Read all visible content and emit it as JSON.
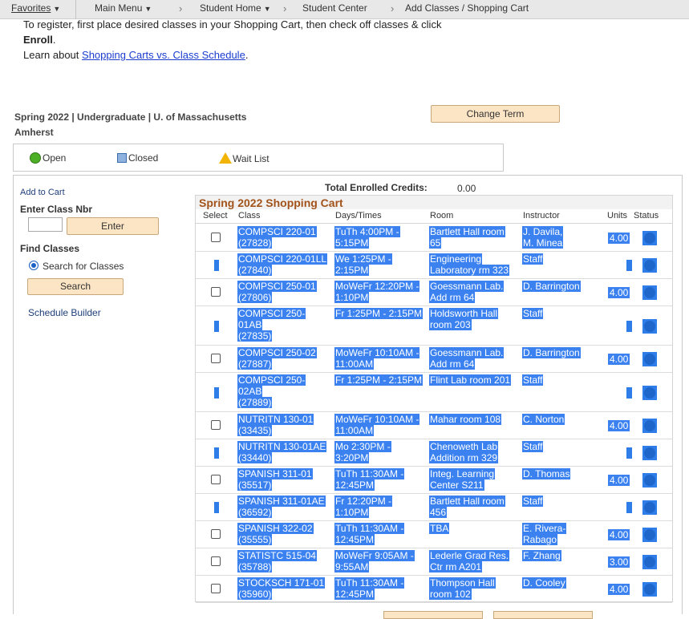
{
  "nav": {
    "favorites": "Favorites",
    "main_menu": "Main Menu",
    "student_home": "Student Home",
    "student_center": "Student Center",
    "add_classes": "Add Classes / Shopping Cart"
  },
  "intro": {
    "line1": "To register, first place desired classes in your Shopping Cart, then check off classes & click",
    "enroll": "Enroll",
    "learn_prefix": "Learn about",
    "learn_link": "Shopping Carts vs. Class Schedule"
  },
  "term": {
    "line1": "Spring 2022 | Undergraduate | U. of Massachusetts",
    "line2": "Amherst",
    "change_term": "Change Term"
  },
  "legend": {
    "open": "Open",
    "closed": "Closed",
    "wait": "Wait List"
  },
  "sidebar": {
    "add_to_cart": "Add to Cart",
    "enter_class_nbr": "Enter Class Nbr",
    "enter_btn": "Enter",
    "find_classes": "Find Classes",
    "search_for_classes": "Search for Classes",
    "search_btn": "Search",
    "schedule_builder": "Schedule Builder"
  },
  "credits": {
    "label": "Total Enrolled Credits:",
    "value": "0.00"
  },
  "cart": {
    "title": "Spring 2022 Shopping Cart",
    "columns": [
      "Select",
      "Class",
      "Days/Times",
      "Room",
      "Instructor",
      "Units",
      "Status"
    ],
    "rows": [
      {
        "class1": "COMPSCI 220-01",
        "class2": "(27828)",
        "class3": "",
        "dt1": "TuTh 4:00PM -",
        "dt2": "5:15PM",
        "room1": "Bartlett Hall room",
        "room2": "65",
        "instr1": "J. Davila,",
        "instr2": "M. Minea",
        "units": "4.00",
        "selectable": true
      },
      {
        "class1": "COMPSCI 220-01LL",
        "class2": "(27840)",
        "class3": "",
        "dt1": "We 1:25PM -",
        "dt2": "2:15PM",
        "room1": "Engineering",
        "room2": "Laboratory rm 323",
        "instr1": "Staff",
        "instr2": "",
        "units": "",
        "selectable": false
      },
      {
        "class1": "COMPSCI 250-01",
        "class2": "(27806)",
        "class3": "",
        "dt1": "MoWeFr 12:20PM -",
        "dt2": "1:10PM",
        "room1": "Goessmann Lab.",
        "room2": "Add rm 64",
        "instr1": "D. Barrington",
        "instr2": "",
        "units": "4.00",
        "selectable": true
      },
      {
        "class1": "COMPSCI 250-",
        "class2": "01AB",
        "class3": "(27835)",
        "dt1": "Fr 1:25PM - 2:15PM",
        "dt2": "",
        "room1": "Holdsworth Hall",
        "room2": "room 203",
        "instr1": "Staff",
        "instr2": "",
        "units": "",
        "selectable": false
      },
      {
        "class1": "COMPSCI 250-02",
        "class2": "(27887)",
        "class3": "",
        "dt1": "MoWeFr 10:10AM -",
        "dt2": "11:00AM",
        "room1": "Goessmann Lab.",
        "room2": "Add rm 64",
        "instr1": "D. Barrington",
        "instr2": "",
        "units": "4.00",
        "selectable": true
      },
      {
        "class1": "COMPSCI 250-",
        "class2": "02AB",
        "class3": "(27889)",
        "dt1": "Fr 1:25PM - 2:15PM",
        "dt2": "",
        "room1": "Flint Lab room 201",
        "room2": "",
        "instr1": "Staff",
        "instr2": "",
        "units": "",
        "selectable": false
      },
      {
        "class1": "NUTRITN 130-01",
        "class2": "(33435)",
        "class3": "",
        "dt1": "MoWeFr 10:10AM -",
        "dt2": "11:00AM",
        "room1": "Mahar room 108",
        "room2": "",
        "instr1": "C. Norton",
        "instr2": "",
        "units": "4.00",
        "selectable": true
      },
      {
        "class1": "NUTRITN 130-01AE",
        "class2": "(33440)",
        "class3": "",
        "dt1": "Mo 2:30PM -",
        "dt2": "3:20PM",
        "room1": "Chenoweth Lab",
        "room2": "Addition rm 329",
        "instr1": "Staff",
        "instr2": "",
        "units": "",
        "selectable": false
      },
      {
        "class1": "SPANISH 311-01",
        "class2": "(35517)",
        "class3": "",
        "dt1": "TuTh 11:30AM -",
        "dt2": "12:45PM",
        "room1": "Integ. Learning",
        "room2": "Center S211",
        "instr1": "D. Thomas",
        "instr2": "",
        "units": "4.00",
        "selectable": true
      },
      {
        "class1": "SPANISH 311-01AE",
        "class2": "(36592)",
        "class3": "",
        "dt1": "Fr 12:20PM -",
        "dt2": "1:10PM",
        "room1": "Bartlett Hall room",
        "room2": "456",
        "instr1": "Staff",
        "instr2": "",
        "units": "",
        "selectable": false
      },
      {
        "class1": "SPANISH 322-02",
        "class2": "(35555)",
        "class3": "",
        "dt1": "TuTh 11:30AM -",
        "dt2": "12:45PM",
        "room1": "TBA",
        "room2": "",
        "instr1": "E. Rivera-",
        "instr2": "Rabago",
        "units": "4.00",
        "selectable": true
      },
      {
        "class1": "STATISTC 515-04",
        "class2": "(35788)",
        "class3": "",
        "dt1": "MoWeFr 9:05AM -",
        "dt2": "9:55AM",
        "room1": "Lederle Grad Res.",
        "room2": "Ctr rm A201",
        "instr1": "F. Zhang",
        "instr2": "",
        "units": "3.00",
        "selectable": true
      },
      {
        "class1": "STOCKSCH 171-01",
        "class2": "(35960)",
        "class3": "",
        "dt1": "TuTh 11:30AM -",
        "dt2": "12:45PM",
        "room1": "Thompson Hall",
        "room2": "room 102",
        "instr1": "D. Cooley",
        "instr2": "",
        "units": "4.00",
        "selectable": true
      }
    ]
  }
}
